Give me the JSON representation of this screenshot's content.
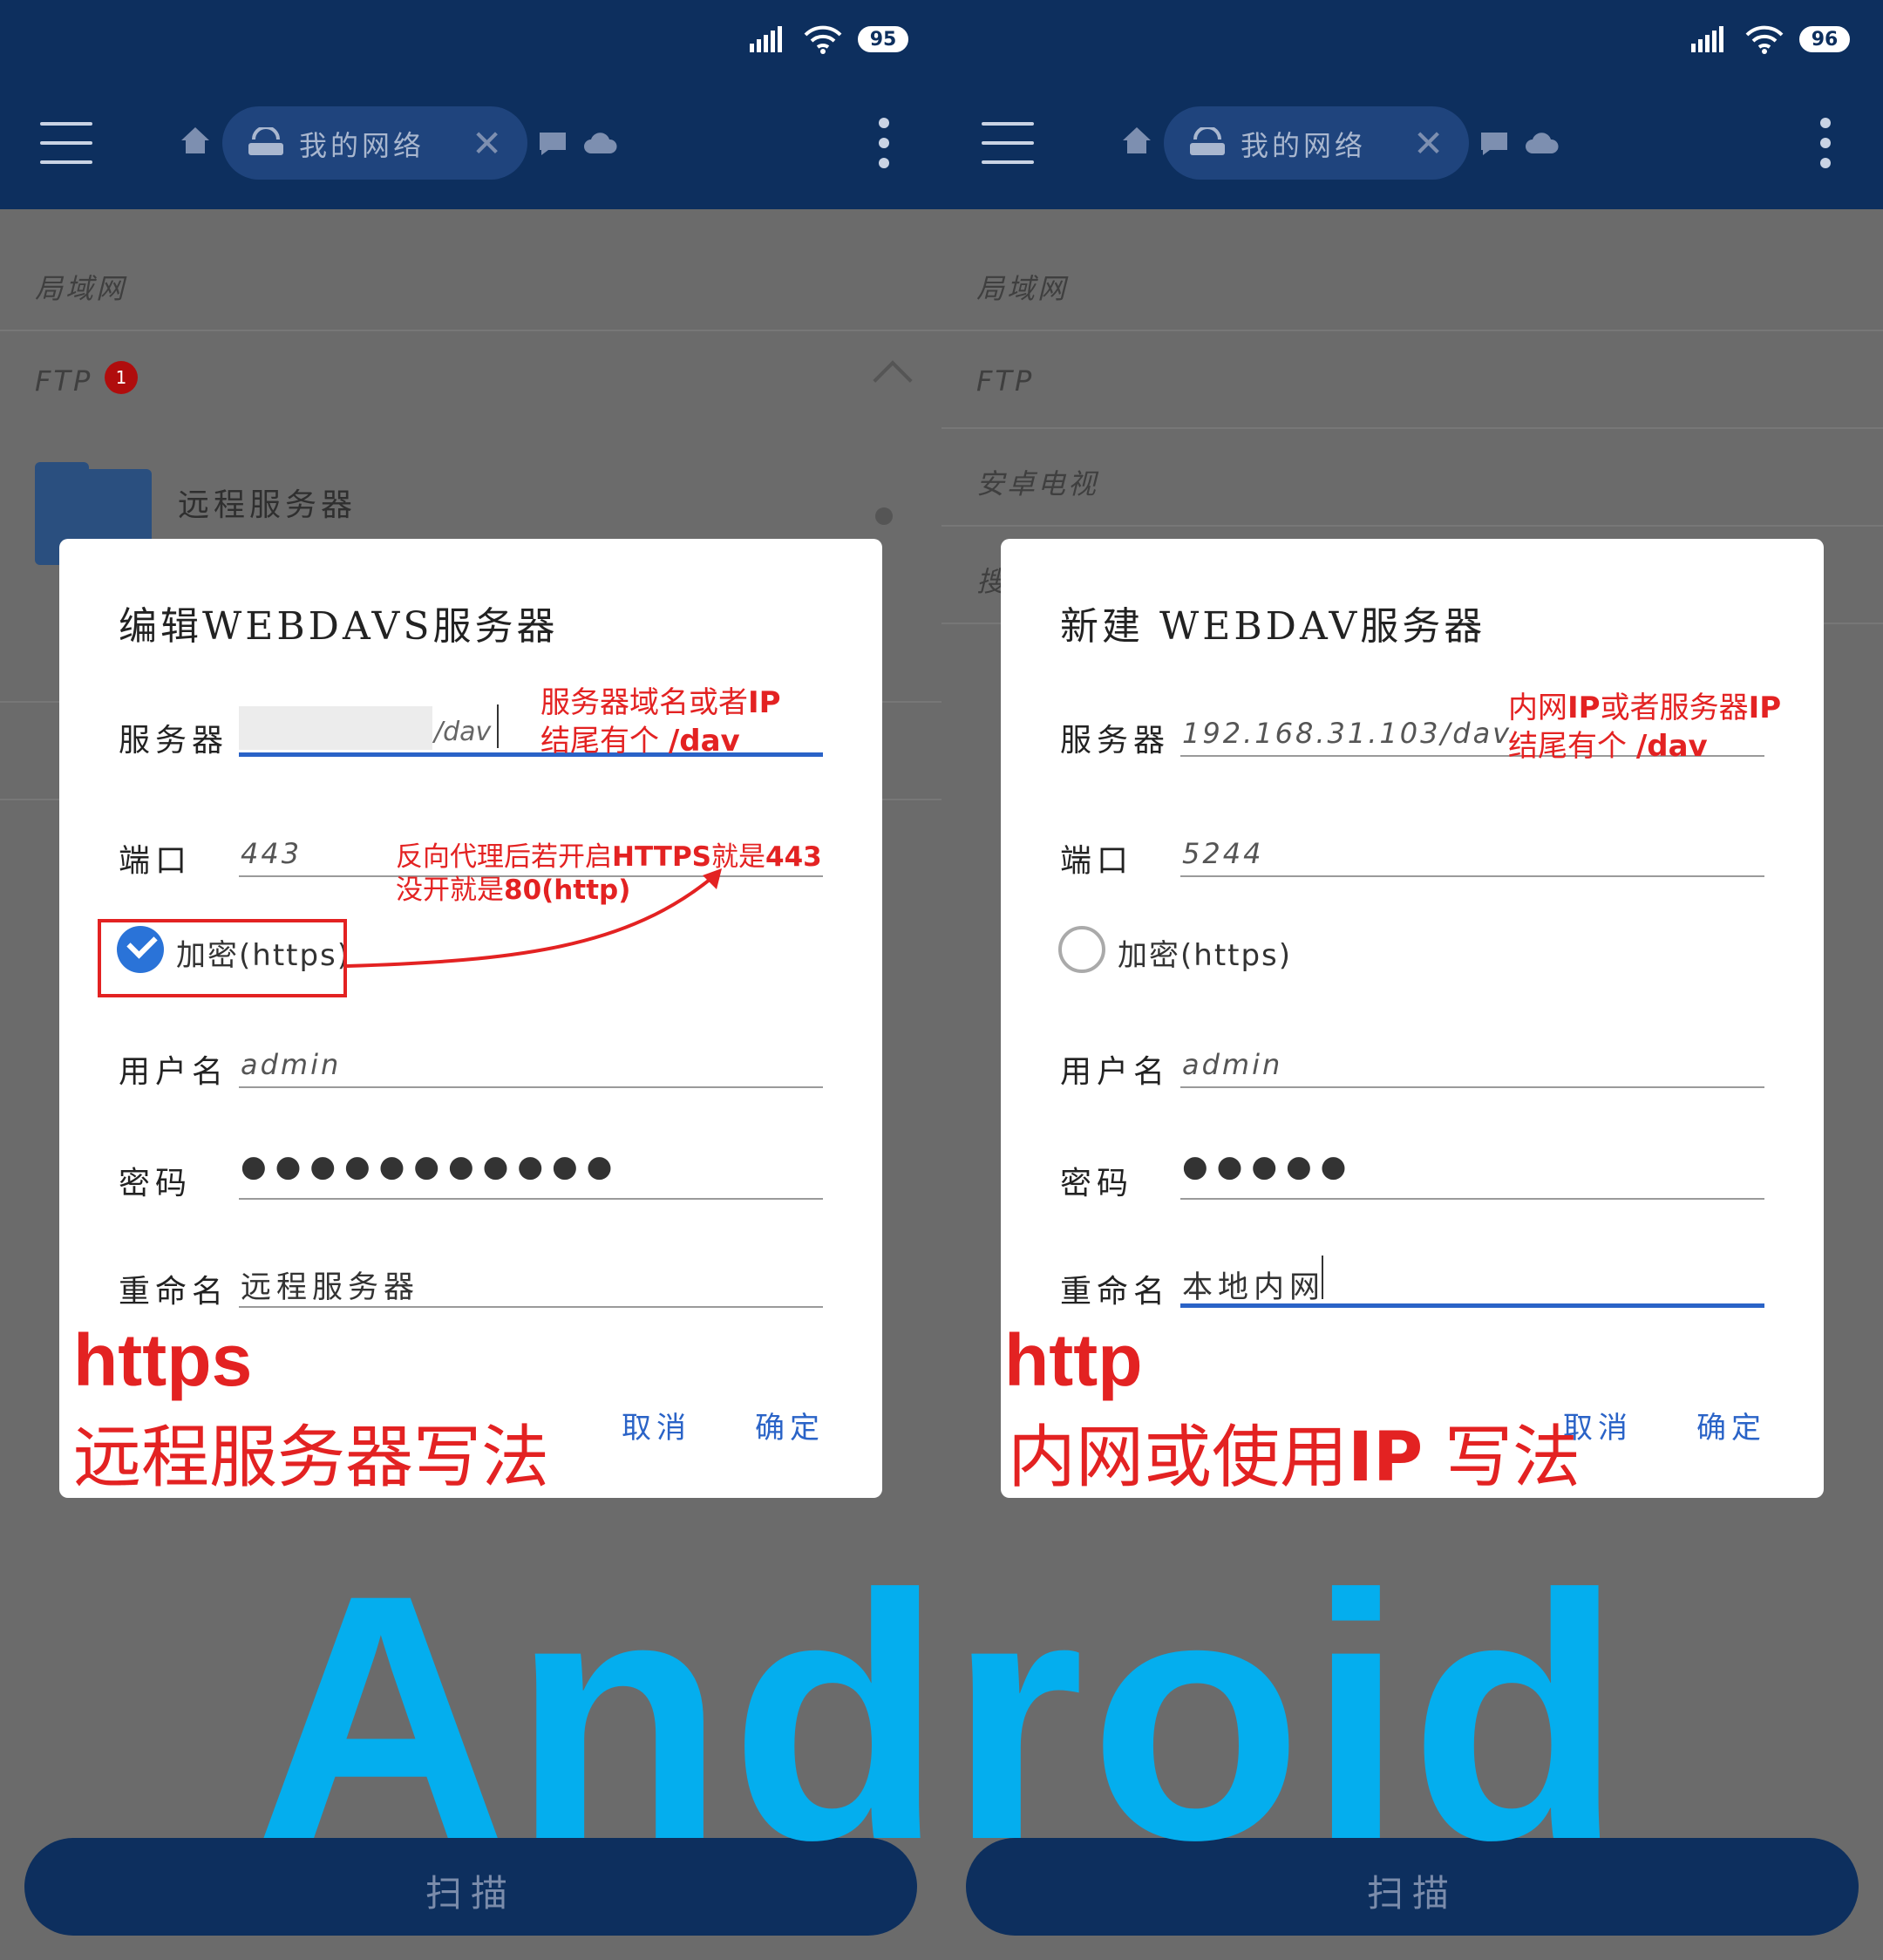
{
  "left": {
    "status": {
      "battery": "95"
    },
    "appbar": {
      "tab_label": "我的网络"
    },
    "list": {
      "lan": "局域网",
      "ftp": "FTP",
      "ftp_badge": "1",
      "folder_title": "远程服务器"
    },
    "dialog": {
      "title": "编辑WEBDAVS服务器",
      "server_label": "服务器",
      "server_suffix": "/dav",
      "port_label": "端口",
      "port_value": "443",
      "encrypt_label": "加密(https)",
      "encrypt_checked": true,
      "username_label": "用户名",
      "username_value": "admin",
      "password_label": "密码",
      "password_value": "●●●●●●●●●●●",
      "rename_label": "重命名",
      "rename_value": "远程服务器",
      "cancel": "取消",
      "confirm": "确定"
    },
    "annotations": {
      "server_note_1": "服务器域名或者",
      "server_note_1_bold": "IP",
      "server_note_2": "结尾有个 ",
      "server_note_2_bold": "/dav",
      "port_note_1": "反向代理后若开启",
      "port_note_1_bold": "HTTPS",
      "port_note_1b": "就是",
      "port_note_1c": "443",
      "port_note_2": "没开就是",
      "port_note_2_bold": "80(http)",
      "big_title": "https",
      "big_subtitle": "远程服务器写法"
    },
    "scan": "扫描"
  },
  "right": {
    "status": {
      "battery": "96"
    },
    "appbar": {
      "tab_label": "我的网络"
    },
    "list": {
      "lan": "局域网",
      "ftp": "FTP",
      "tv": "安卓电视",
      "partial": "搜"
    },
    "dialog": {
      "title": "新建 WEBDAV服务器",
      "server_label": "服务器",
      "server_value": "192.168.31.103/dav",
      "port_label": "端口",
      "port_value": "5244",
      "encrypt_label": "加密(https)",
      "encrypt_checked": false,
      "username_label": "用户名",
      "username_value": "admin",
      "password_label": "密码",
      "password_value": "●●●●●",
      "rename_label": "重命名",
      "rename_value": "本地内网",
      "cancel": "取消",
      "confirm": "确定"
    },
    "annotations": {
      "server_note_1": "内网",
      "server_note_1_bold": "IP",
      "server_note_1b": "或者服务器",
      "server_note_1c": "IP",
      "server_note_2": "结尾有个 ",
      "server_note_2_bold": "/dav",
      "big_title": "http",
      "big_subtitle_1": "内网或使用",
      "big_subtitle_bold": "IP",
      "big_subtitle_2": " 写法"
    },
    "scan": "扫描"
  },
  "overlay": {
    "android": "Android"
  },
  "colors": {
    "appbar": "#0d2f5e",
    "accent": "#2a63c7",
    "annotation": "#e32222",
    "android": "#04aeee"
  },
  "icons": [
    "signal-icon",
    "wifi-icon",
    "battery-icon",
    "menu-icon",
    "home-icon",
    "router-icon",
    "close-icon",
    "chat-bubble-icon",
    "cloud-icon",
    "more-vert-icon",
    "folder-icon",
    "chevron-up-icon",
    "check-icon"
  ]
}
